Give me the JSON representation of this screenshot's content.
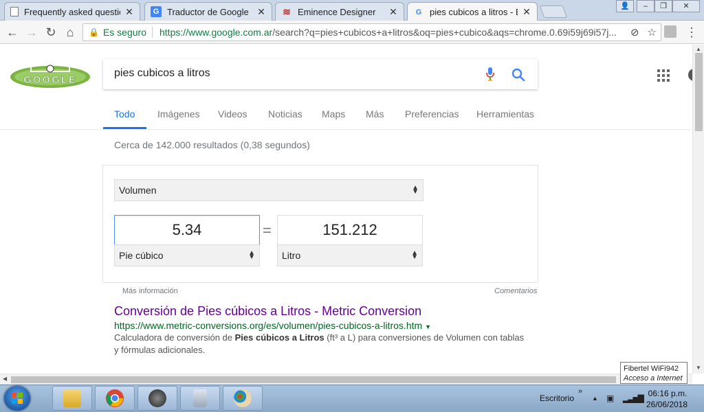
{
  "browser": {
    "tabs": [
      {
        "title": "Frequently asked questio",
        "icon": "page-icon"
      },
      {
        "title": "Traductor de Google",
        "icon": "google-translate-icon"
      },
      {
        "title": "Eminence Designer",
        "icon": "eminence-icon"
      },
      {
        "title": "pies cubicos a litros - Bus",
        "icon": "google-g-icon"
      }
    ],
    "omnibox": {
      "secure_label": "Es seguro",
      "url_host": "https://www.google.com.ar",
      "url_path": "/search?q=pies+cubicos+a+litros&oq=pies+cubico&aqs=chrome.0.69i59j69i57j..."
    }
  },
  "search": {
    "query": "pies cubicos a litros",
    "tabs": [
      "Todo",
      "Imágenes",
      "Videos",
      "Noticias",
      "Maps",
      "Más",
      "Preferencias",
      "Herramientas"
    ],
    "active_tab": "Todo",
    "results_count": "Cerca de 142.000 resultados (0,38 segundos)"
  },
  "converter": {
    "category": "Volumen",
    "from_value": "5.34",
    "to_value": "151.212",
    "from_unit": "Pie cúbico",
    "to_unit": "Litro",
    "more_info": "Más información",
    "feedback": "Comentarios"
  },
  "result": {
    "title": "Conversión de Pies cúbicos a Litros - Metric Conversion",
    "url": "https://www.metric-conversions.org/es/volumen/pies-cubicos-a-litros.htm",
    "snippet_1": "Calculadora de conversión de ",
    "snippet_bold": "Pies cúbicos a Litros",
    "snippet_2": " (ft³ a L) para conversiones de Volumen con tablas",
    "snippet_3": "y fórmulas adicionales."
  },
  "tooltip": {
    "line1": "Fibertel WiFi942",
    "line2": "Acceso a Internet"
  },
  "taskbar": {
    "desktop_label": "Escritorio",
    "time": "06:16 p.m.",
    "date": "26/06/2018"
  },
  "colors": {
    "accent": "#1a73e8",
    "visited_link": "#660099",
    "url_green": "#006621"
  }
}
